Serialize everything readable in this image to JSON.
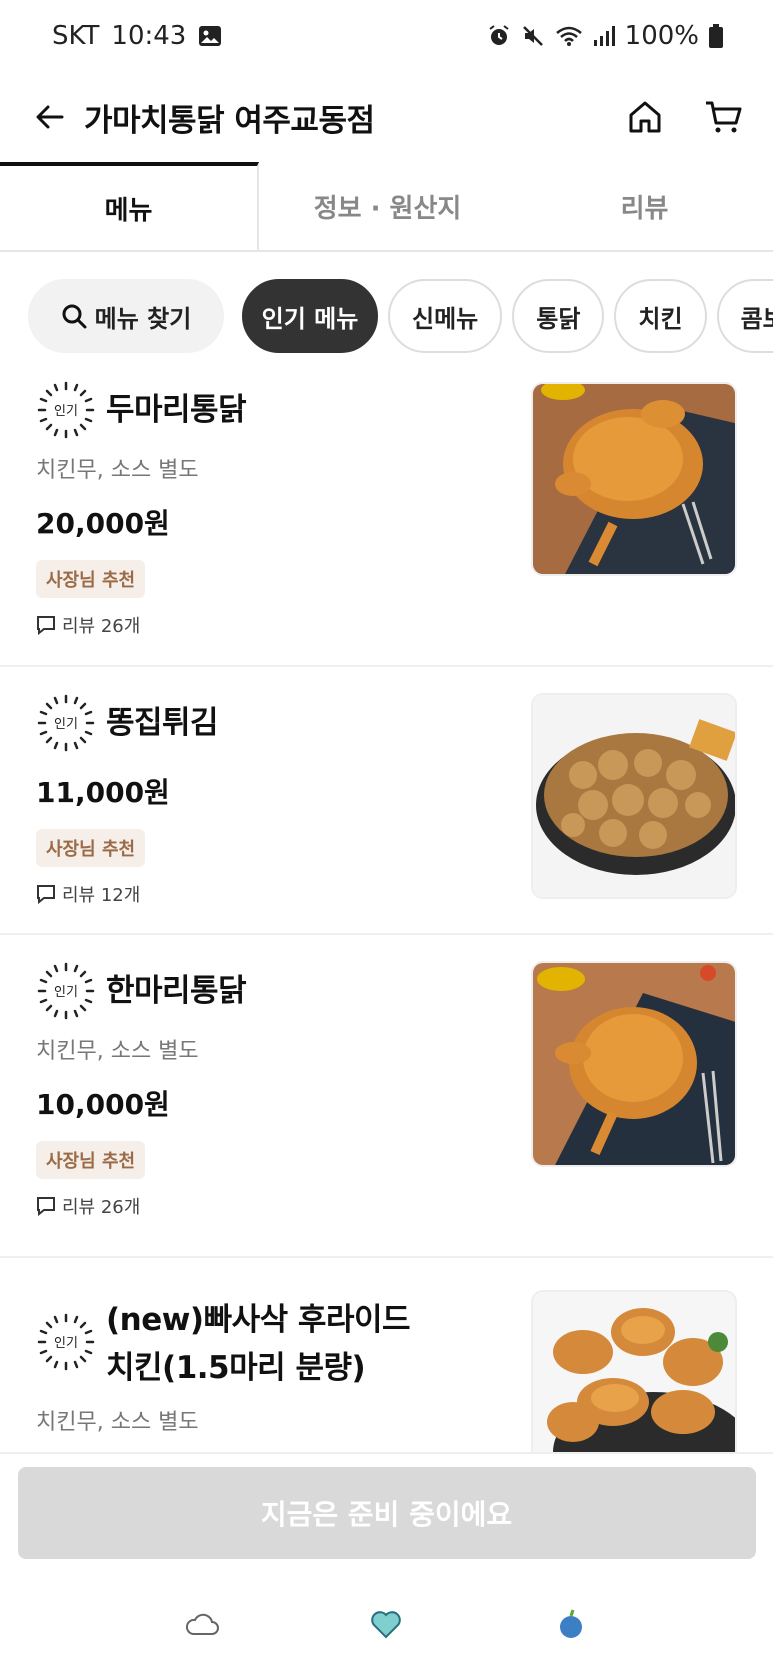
{
  "status_bar": {
    "carrier": "SKT",
    "time": "10:43",
    "battery": "100%",
    "icons": [
      "gallery-icon",
      "alarm-icon",
      "mute-icon",
      "wifi-icon",
      "signal-icon",
      "battery-icon"
    ]
  },
  "header": {
    "title": "가마치통닭 여주교동점",
    "icons": [
      "back-arrow-icon",
      "home-icon",
      "cart-icon"
    ]
  },
  "tabs": [
    {
      "label": "메뉴",
      "active": true
    },
    {
      "label": "정보 · 원산지",
      "active": false
    },
    {
      "label": "리뷰",
      "active": false
    }
  ],
  "chips": {
    "search_label": "메뉴 찾기",
    "categories": [
      {
        "label": "인기 메뉴",
        "active": true
      },
      {
        "label": "신메뉴",
        "active": false
      },
      {
        "label": "통닭",
        "active": false
      },
      {
        "label": "치킨",
        "active": false
      },
      {
        "label": "콤보",
        "active": false
      }
    ]
  },
  "badge_label": "인기",
  "menu_items": [
    {
      "name": "두마리통닭",
      "desc": "치킨무, 소스 별도",
      "price": "20,000원",
      "tag": "사장님 추천",
      "reviews": "리뷰 26개"
    },
    {
      "name": "똥집튀김",
      "desc": "",
      "price": "11,000원",
      "tag": "사장님 추천",
      "reviews": "리뷰 12개"
    },
    {
      "name": "한마리통닭",
      "desc": "치킨무, 소스 별도",
      "price": "10,000원",
      "tag": "사장님 추천",
      "reviews": "리뷰 26개"
    },
    {
      "name_line1": "(new)빠사삭 후라이드",
      "name_line2": "치킨(1.5마리 분량)",
      "desc": "치킨무, 소스 별도"
    }
  ],
  "order_button": {
    "label": "지금은 준비 중이에요"
  },
  "bottom_nav": [
    "cloud-icon",
    "heart-icon",
    "fruit-icon"
  ]
}
